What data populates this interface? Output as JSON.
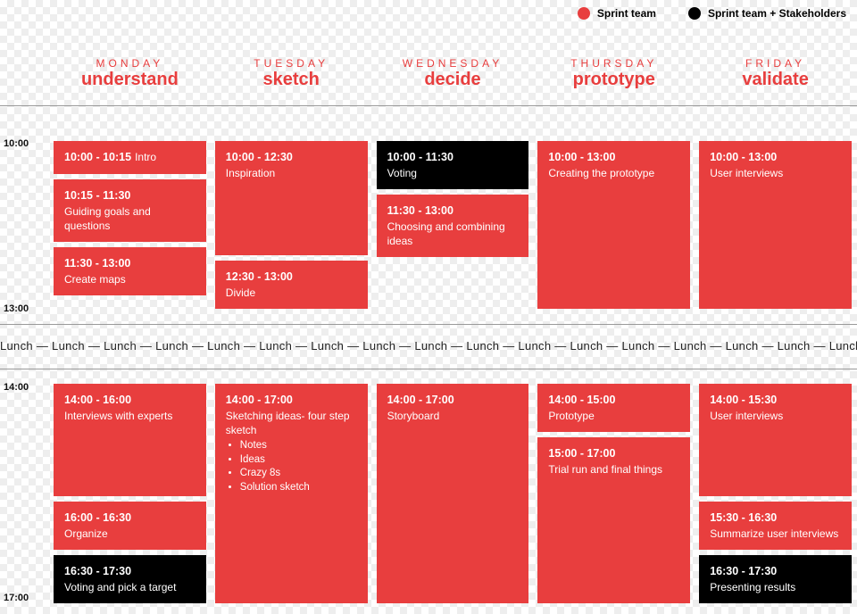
{
  "legend": {
    "sprint_team": "Sprint team",
    "sprint_team_stakeholders": "Sprint team + Stakeholders"
  },
  "days": {
    "mon": {
      "label": "MONDAY",
      "theme": "understand"
    },
    "tue": {
      "label": "TUESDAY",
      "theme": "sketch"
    },
    "wed": {
      "label": "WEDNESDAY",
      "theme": "decide"
    },
    "thu": {
      "label": "THURSDAY",
      "theme": "prototype"
    },
    "fri": {
      "label": "FRIDAY",
      "theme": "validate"
    }
  },
  "time_labels": {
    "t10": "10:00",
    "t13": "13:00",
    "t14": "14:00",
    "t17": "17:00"
  },
  "lunch_text": "Lunch — Lunch — Lunch — Lunch — Lunch — Lunch — Lunch — Lunch — Lunch — Lunch — Lunch — Lunch — Lunch — Lunch — Lunch — Lunch — Lunch",
  "morning": {
    "mon": [
      {
        "time": "10:00 - 10:15",
        "title": "Intro",
        "color": "red",
        "inline": true
      },
      {
        "time": "10:15 - 11:30",
        "title": "Guiding goals and questions",
        "color": "red"
      },
      {
        "time": "11:30 - 13:00",
        "title": "Create maps",
        "color": "red"
      }
    ],
    "tue": [
      {
        "time": "10:00 - 12:30",
        "title": "Inspiration",
        "color": "red",
        "grow": true
      },
      {
        "time": "12:30 - 13:00",
        "title": "Divide",
        "color": "red"
      }
    ],
    "wed": [
      {
        "time": "10:00 - 11:30",
        "title": "Voting",
        "color": "black"
      },
      {
        "time": "11:30 - 13:00",
        "title": "Choosing and combining ideas",
        "color": "red"
      }
    ],
    "thu": [
      {
        "time": "10:00 - 13:00",
        "title": "Creating the prototype",
        "color": "red",
        "grow": true
      }
    ],
    "fri": [
      {
        "time": "10:00 - 13:00",
        "title": "User interviews",
        "color": "red",
        "grow": true
      }
    ]
  },
  "afternoon": {
    "mon": [
      {
        "time": "14:00 - 16:00",
        "title": "Interviews with experts",
        "color": "red",
        "grow": true
      },
      {
        "time": "16:00 - 16:30",
        "title": "Organize",
        "color": "red"
      },
      {
        "time": "16:30 - 17:30",
        "title": "Voting and pick a target",
        "color": "black"
      }
    ],
    "tue": [
      {
        "time": "14:00 - 17:00",
        "title": "Sketching ideas- four step sketch",
        "color": "red",
        "grow": true,
        "bullets": [
          "Notes",
          "Ideas",
          "Crazy 8s",
          "Solution sketch"
        ]
      }
    ],
    "wed": [
      {
        "time": "14:00 - 17:00",
        "title": "Storyboard",
        "color": "red",
        "grow": true
      }
    ],
    "thu": [
      {
        "time": "14:00 - 15:00",
        "title": "Prototype",
        "color": "red"
      },
      {
        "time": "15:00 - 17:00",
        "title": "Trial run and final things",
        "color": "red",
        "grow": true
      }
    ],
    "fri": [
      {
        "time": "14:00 - 15:30",
        "title": "User interviews",
        "color": "red",
        "grow": true
      },
      {
        "time": "15:30 - 16:30",
        "title": "Summarize user interviews",
        "color": "red"
      },
      {
        "time": "16:30 - 17:30",
        "title": "Presenting results",
        "color": "black"
      }
    ]
  }
}
